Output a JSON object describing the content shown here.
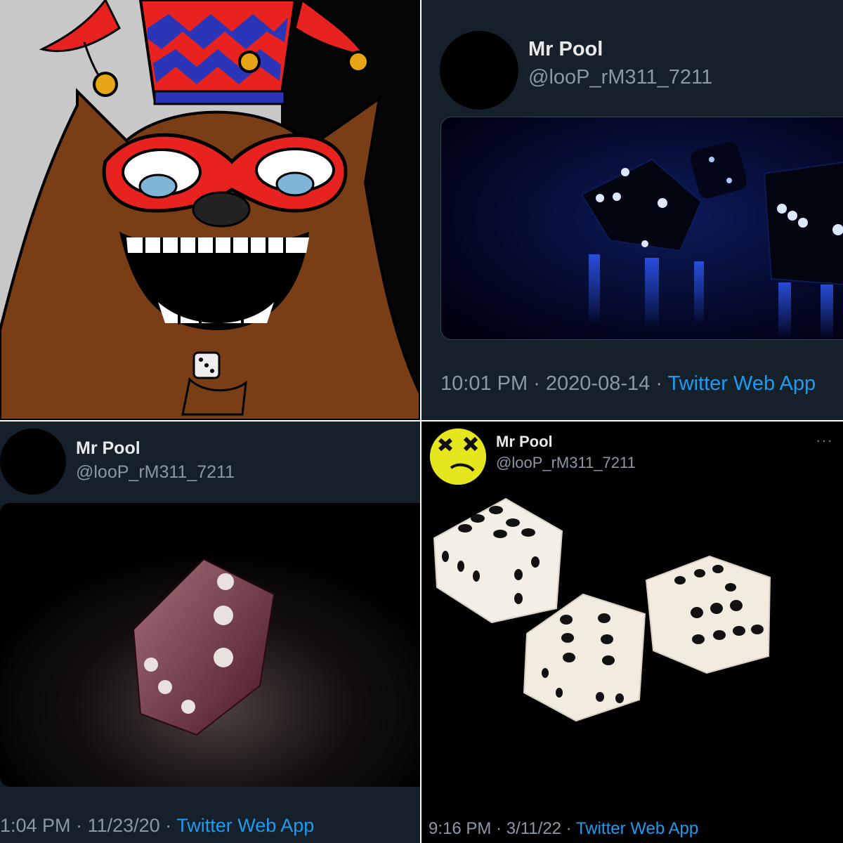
{
  "panels": {
    "artwork": {
      "icon": "jester-wolf-illustration"
    },
    "tweet_1": {
      "author_name": "Mr Pool",
      "author_handle": "@looP_rM311_7211",
      "time": "10:01 PM",
      "date": "2020-08-14",
      "separator": " · ",
      "source": "Twitter Web App",
      "media_icon": "blue-dice-photo"
    },
    "tweet_2": {
      "author_name": "Mr Pool",
      "author_handle": "@looP_rM311_7211",
      "time": "1:04 PM",
      "date": "11/23/20",
      "separator": " · ",
      "source": "Twitter Web App",
      "media_icon": "red-die-photo"
    },
    "tweet_3": {
      "author_name": "Mr Pool",
      "author_handle": "@looP_rM311_7211",
      "more_label": "···",
      "time": "9:16 PM",
      "date": "3/11/22",
      "separator": " · ",
      "source": "Twitter Web App",
      "media_icon": "white-dice-photo",
      "avatar_icon": "yellow-smiley-avatar"
    }
  },
  "colors": {
    "background_dark": "#15202b",
    "link_blue": "#1d9bf0",
    "secondary_text": "#8b98a5",
    "primary_text": "#e7e9ea",
    "avatar_yellow": "#e6e61e"
  }
}
